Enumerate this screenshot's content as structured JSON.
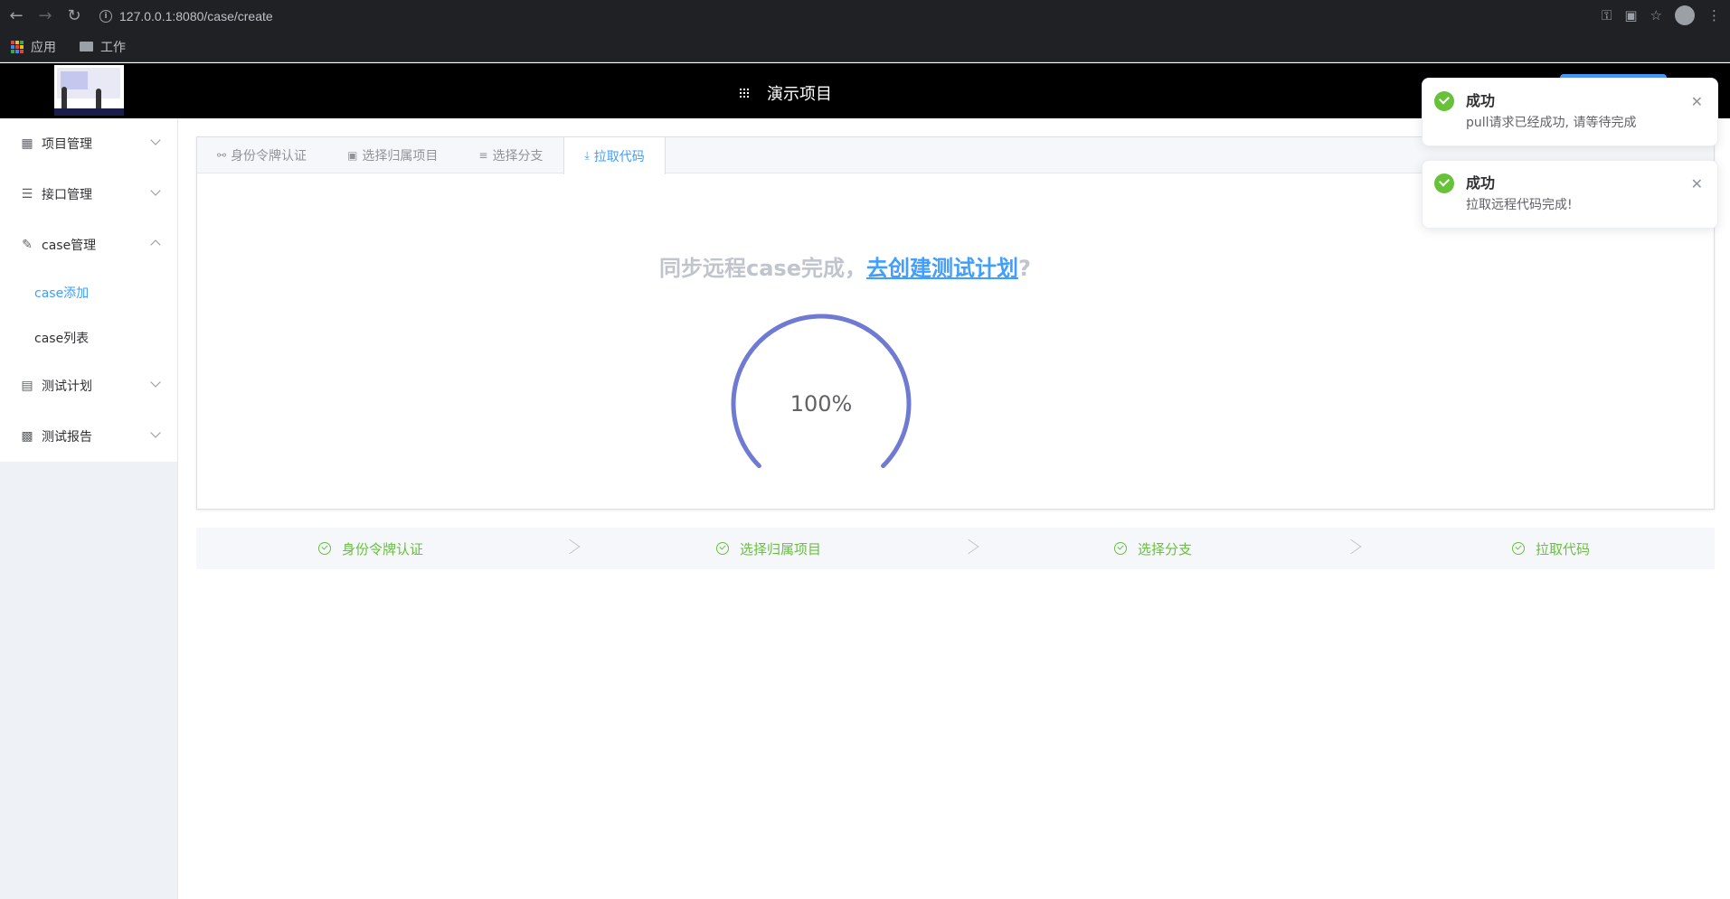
{
  "browser": {
    "url": "127.0.0.1:8080/case/create",
    "bookmarks": [
      {
        "label": "应用"
      },
      {
        "label": "工作"
      }
    ]
  },
  "header": {
    "project_title": "演示项目"
  },
  "sidebar": {
    "items": [
      {
        "label": "项目管理",
        "icon": "grid-icon",
        "expanded": false
      },
      {
        "label": "接口管理",
        "icon": "list-icon",
        "expanded": false
      },
      {
        "label": "case管理",
        "icon": "edit-icon",
        "expanded": true
      },
      {
        "label": "测试计划",
        "icon": "document-icon",
        "expanded": false
      },
      {
        "label": "测试报告",
        "icon": "bar-chart-icon",
        "expanded": false
      }
    ],
    "sub_items": [
      {
        "label": "case添加",
        "active": true
      },
      {
        "label": "case列表",
        "active": false
      }
    ]
  },
  "tabs": [
    {
      "label": "身份令牌认证",
      "icon": "key-icon"
    },
    {
      "label": "选择归属项目",
      "icon": "monitor-icon"
    },
    {
      "label": "选择分支",
      "icon": "sliders-icon"
    },
    {
      "label": "拉取代码",
      "icon": "download-icon",
      "active": true
    }
  ],
  "sync": {
    "prefix": "同步远程case完成，",
    "link": "去创建测试计划",
    "suffix": "?"
  },
  "progress": {
    "percent": 100,
    "label": "100%",
    "color": "#6f7ad3"
  },
  "steps": [
    {
      "label": "身份令牌认证",
      "status": "success"
    },
    {
      "label": "选择归属项目",
      "status": "success"
    },
    {
      "label": "选择分支",
      "status": "success"
    },
    {
      "label": "拉取代码",
      "status": "success"
    }
  ],
  "notifications": [
    {
      "title": "成功",
      "message": "pull请求已经成功, 请等待完成"
    },
    {
      "title": "成功",
      "message": "拉取远程代码完成!"
    }
  ],
  "colors": {
    "accent": "#409eff",
    "success": "#67c23a",
    "header_bg": "#000000",
    "sidebar_bg": "#eef1f6"
  }
}
